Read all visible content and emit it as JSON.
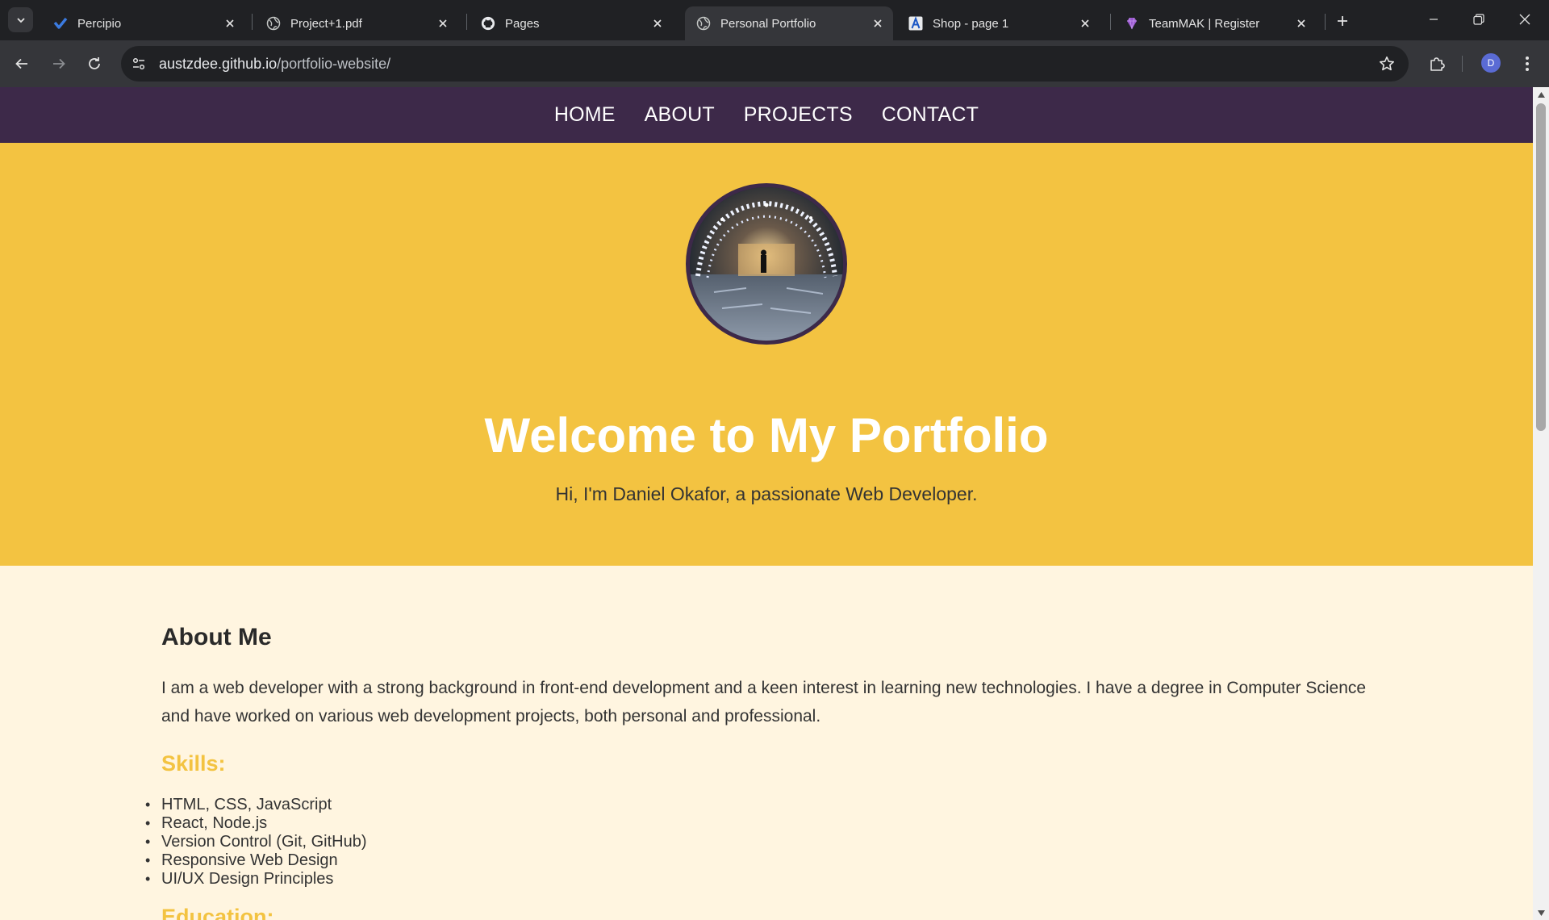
{
  "browser": {
    "tabs": [
      {
        "title": "Percipio",
        "icon": "percipio-icon",
        "active": false
      },
      {
        "title": "Project+1.pdf",
        "icon": "globe-icon",
        "active": false
      },
      {
        "title": "Pages",
        "icon": "github-icon",
        "active": false
      },
      {
        "title": "Personal Portfolio",
        "icon": "globe-icon",
        "active": true
      },
      {
        "title": "Shop - page 1",
        "icon": "shop-icon",
        "active": false
      },
      {
        "title": "TeamMAK | Register",
        "icon": "teammak-icon",
        "active": false
      }
    ],
    "url_host": "austzdee.github.io",
    "url_path": "/portfolio-website/",
    "profile_initial": "D"
  },
  "site": {
    "nav": [
      "HOME",
      "ABOUT",
      "PROJECTS",
      "CONTACT"
    ],
    "hero": {
      "title": "Welcome to My Portfolio",
      "subtitle": "Hi, I'm Daniel Okafor, a passionate Web Developer."
    },
    "about": {
      "heading": "About Me",
      "bio": "I am a web developer with a strong background in front-end development and a keen interest in learning new technologies. I have a degree in Computer Science and have worked on various web development projects, both personal and professional.",
      "skills_heading": "Skills:",
      "skills": [
        "HTML, CSS, JavaScript",
        "React, Node.js",
        "Version Control (Git, GitHub)",
        "Responsive Web Design",
        "UI/UX Design Principles"
      ],
      "education_heading": "Education:"
    }
  },
  "colors": {
    "nav_bg": "#3d2949",
    "hero_bg": "#f3c341",
    "page_bg": "#fff5e0",
    "accent": "#f3c341"
  }
}
